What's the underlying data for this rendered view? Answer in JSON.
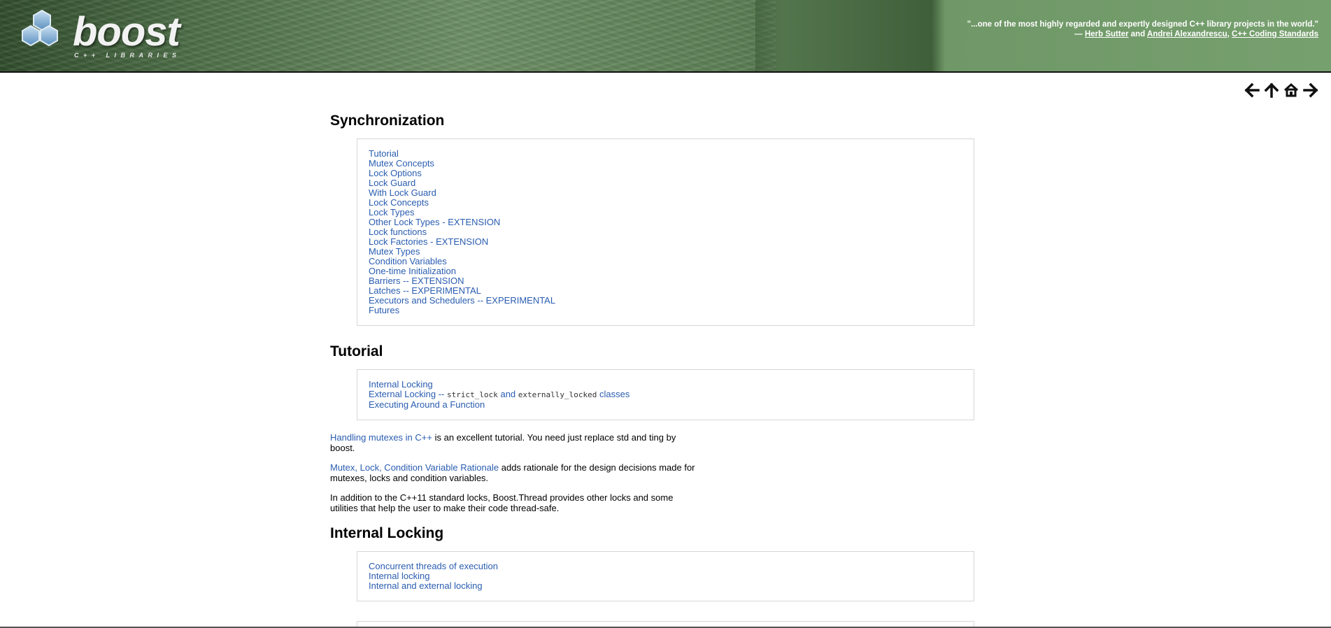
{
  "banner": {
    "logo_text": "boost",
    "logo_subtext": "C++ LIBRARIES",
    "quote_text": "\"...one of the most highly regarded and expertly designed C++ library projects in the world.\"",
    "quote_dash": "— ",
    "author1": "Herb Sutter",
    "and_text": " and ",
    "author2": "Andrei Alexandrescu",
    "comma": ", ",
    "book": "C++ Coding Standards"
  },
  "nav": {
    "prev": "prev-arrow",
    "up": "up-arrow",
    "home": "home-icon",
    "next": "next-arrow"
  },
  "sections": {
    "synchronization": {
      "title": "Synchronization",
      "items": [
        "Tutorial",
        "Mutex Concepts",
        "Lock Options",
        "Lock Guard",
        "With Lock Guard",
        "Lock Concepts",
        "Lock Types",
        "Other Lock Types - EXTENSION",
        "Lock functions",
        "Lock Factories - EXTENSION",
        "Mutex Types",
        "Condition Variables",
        "One-time Initialization",
        "Barriers -- EXTENSION",
        "Latches -- EXPERIMENTAL",
        "Executors and Schedulers -- EXPERIMENTAL",
        "Futures"
      ]
    },
    "tutorial": {
      "title": "Tutorial",
      "item1": "Internal Locking",
      "item2_prefix": "External Locking -- ",
      "item2_code1": "strict_lock",
      "item2_and": " and ",
      "item2_code2": "externally_locked",
      "item2_suffix": " classes",
      "item3": "Executing Around a Function",
      "para1_link": "Handling mutexes in C++",
      "para1_text": " is an excellent tutorial. You need just replace std and ting by boost.",
      "para2_link": "Mutex, Lock, Condition Variable Rationale",
      "para2_text": " adds rationale for the design decisions made for mutexes, locks and condition variables.",
      "para3_text": "In addition to the C++11 standard locks, Boost.Thread provides other locks and some utilities that help the user to make their code thread-safe."
    },
    "internal_locking": {
      "title": "Internal Locking",
      "items": [
        "Concurrent threads of execution",
        "Internal locking",
        "Internal and external locking"
      ]
    }
  },
  "colors": {
    "link": "#2a5db0",
    "banner_green": "#6f9767"
  }
}
